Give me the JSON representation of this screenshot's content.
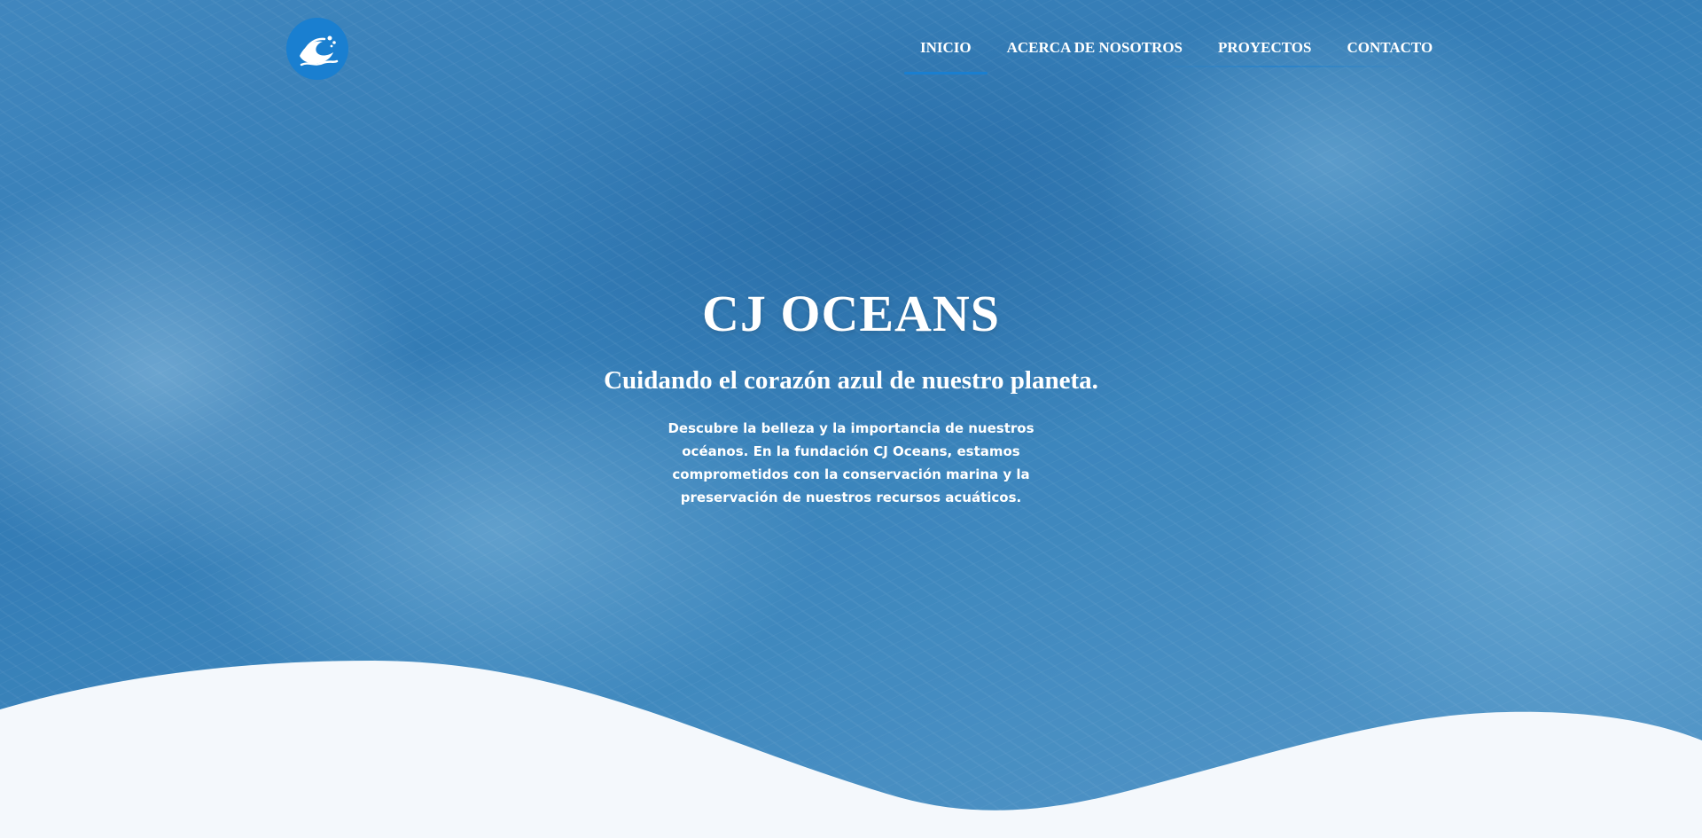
{
  "brand": {
    "logo_icon": "wave-icon",
    "logo_color": "#1a7fd0"
  },
  "nav": {
    "items": [
      {
        "label": "INICIO",
        "active": true
      },
      {
        "label": "ACERCA DE NOSOTROS",
        "active": false
      },
      {
        "label": "PROYECTOS",
        "active": false
      },
      {
        "label": "CONTACTO",
        "active": false
      }
    ]
  },
  "hero": {
    "title": "CJ OCEANS",
    "subtitle": "Cuidando el corazón azul de nuestro planeta.",
    "description": "Descubre la belleza y la importancia de nuestros océanos. En la fundación CJ Oceans, estamos comprometidos con la conservación marina y la preservación de nuestros recursos acuáticos."
  },
  "colors": {
    "accent": "#1a7fd0",
    "wave_fill": "#f4f8fc",
    "ocean": "#2f79b3"
  }
}
